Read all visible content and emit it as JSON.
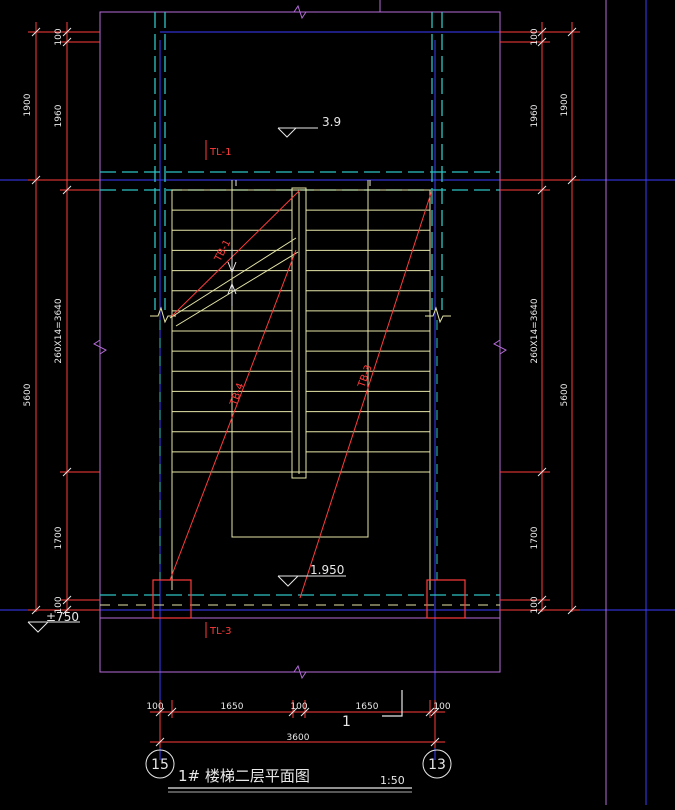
{
  "drawing": {
    "title": "1# 楼梯二层平面图",
    "scale": "1:50",
    "colors": {
      "wall": "#b46bd9",
      "beam_dashed": "#2ec4c4",
      "grid_axis": "#3b3bff",
      "dimension": "#ff3b3b",
      "tread": "#e6e6a8",
      "text": "#e8e8e8",
      "column": "#ff3b3b"
    }
  },
  "levels": {
    "top_landing": "3.9",
    "mid_landing": "1.950",
    "bottom": "±750"
  },
  "tags": {
    "beam_top": "TL-1",
    "beam_bottom": "TL-3",
    "flight_upper": "TB-1",
    "flight_left": "TB-4",
    "flight_right": "TB-3"
  },
  "dims_left": {
    "outer_total": "1900",
    "outer_main": "5600",
    "inner_a": "100",
    "inner_b": "1960",
    "inner_c": "260X14=3640",
    "inner_d": "1700",
    "inner_e": "100"
  },
  "dims_right": {
    "outer_total": "1900",
    "outer_main": "5600",
    "inner_a": "100",
    "inner_b": "1960",
    "inner_c": "260X14=3640",
    "inner_d": "1700",
    "inner_e": "100"
  },
  "dims_bottom": {
    "seg_1": "100",
    "seg_2": "1650",
    "seg_3": "100",
    "seg_4": "1650",
    "seg_5": "100",
    "total": "3600",
    "section_mark": "1"
  },
  "grid_axes": {
    "left": "15",
    "right": "13"
  }
}
